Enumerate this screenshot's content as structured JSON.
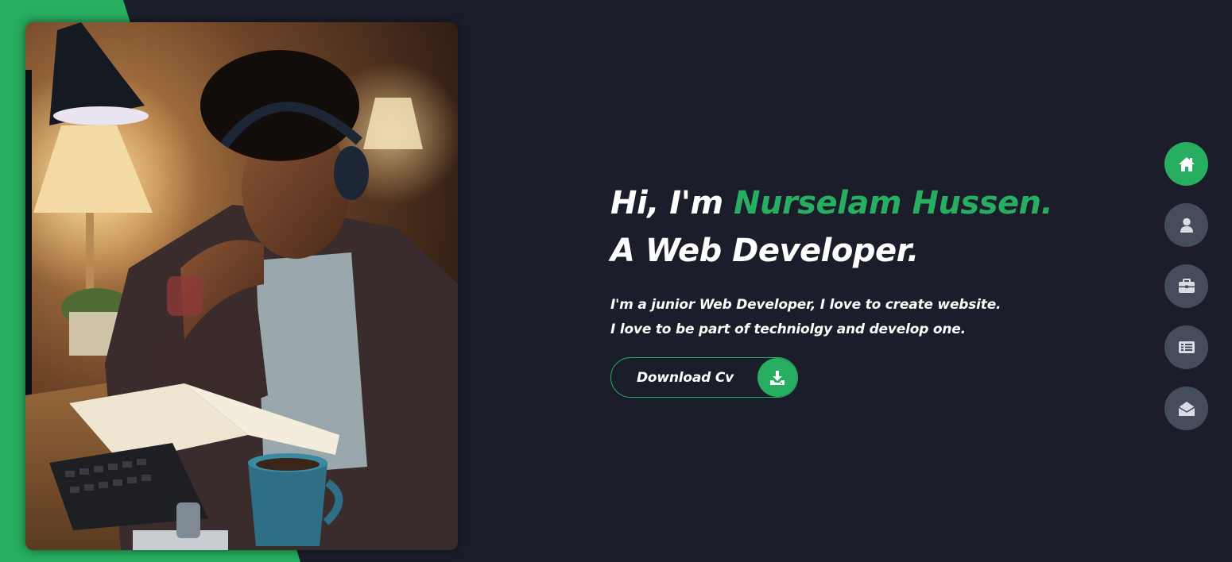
{
  "hero": {
    "greeting": "Hi, I'm ",
    "name": "Nurselam Hussen.",
    "role_line": "A Web Developer.",
    "description": "I'm a junior Web Developer, I love to create website. I love to be part of techniolgy and develop one.",
    "cv_button_label": "Download Cv",
    "cv_button_icon": "download-icon"
  },
  "nav": {
    "items": [
      {
        "icon": "home-icon",
        "active": true
      },
      {
        "icon": "user-icon",
        "active": false
      },
      {
        "icon": "briefcase-icon",
        "active": false
      },
      {
        "icon": "list-icon",
        "active": false
      },
      {
        "icon": "envelope-open-icon",
        "active": false
      }
    ]
  },
  "colors": {
    "background": "#1b1d2a",
    "accent": "#27ae60",
    "nav_inactive": "#454c5c",
    "text": "#ffffff"
  }
}
